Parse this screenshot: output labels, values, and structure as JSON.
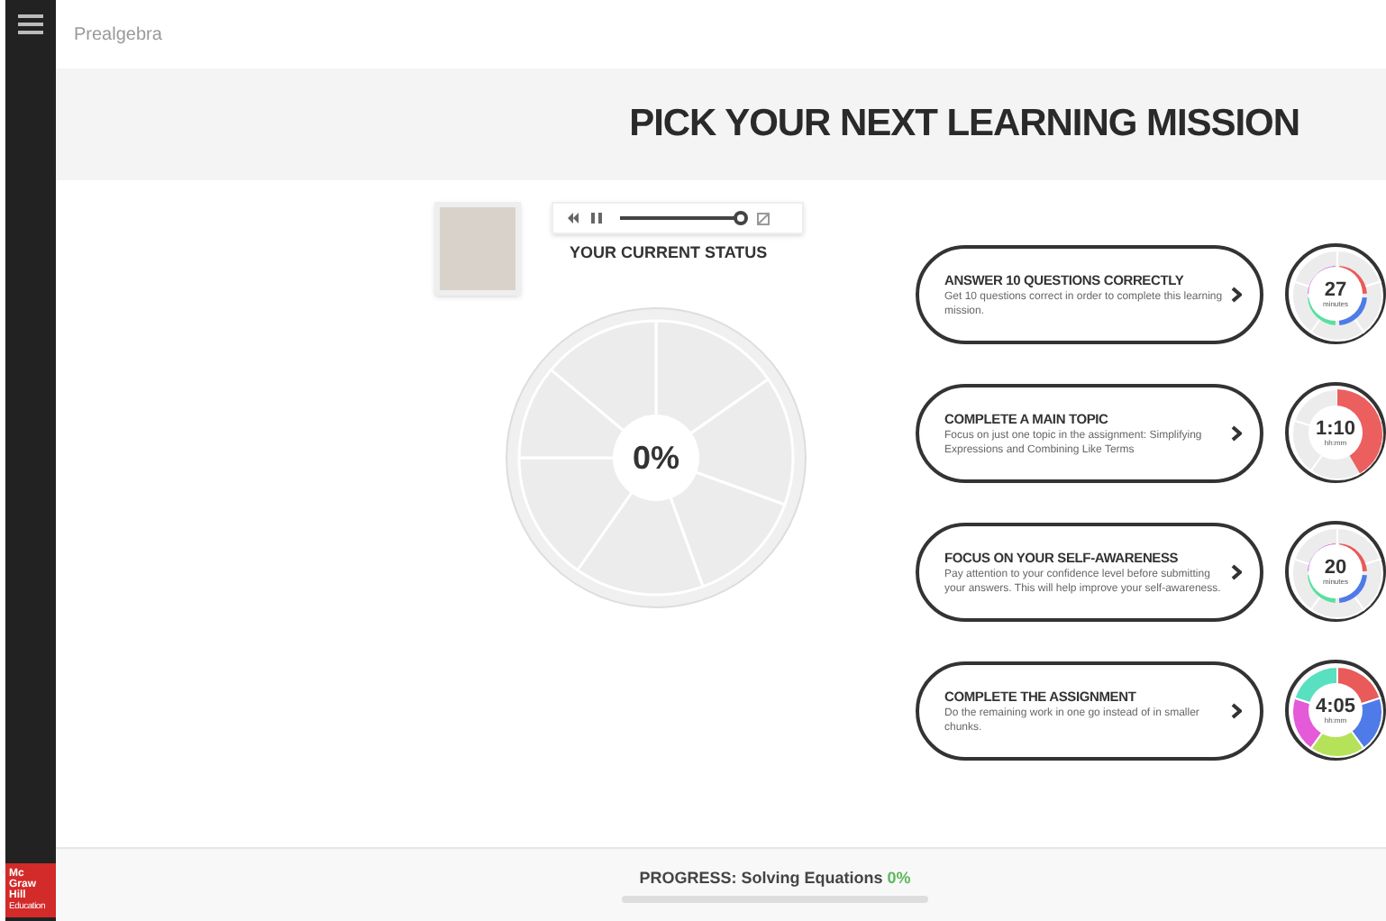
{
  "header": {
    "course": "Prealgebra"
  },
  "title": "PICK YOUR NEXT LEARNING MISSION",
  "audio": {
    "level": 0.95
  },
  "status": {
    "label": "YOUR CURRENT STATUS",
    "percent": "0%"
  },
  "missions": [
    {
      "title": "ANSWER 10 QUESTIONS CORRECTLY",
      "description": "Get 10 questions correct in order to complete this learning mission.",
      "time": "27",
      "unit": "minutes",
      "kind": "ring"
    },
    {
      "title": "COMPLETE A MAIN TOPIC",
      "description": "Focus on just one topic in the assignment: Simplifying Expressions and Combining Like Terms",
      "time": "1:10",
      "unit": "hh:mm",
      "kind": "slice"
    },
    {
      "title": "FOCUS ON YOUR SELF-AWARENESS",
      "description": "Pay attention to your confidence level before submitting your answers. This will help improve your self-awareness.",
      "time": "20",
      "unit": "minutes",
      "kind": "ring"
    },
    {
      "title": "COMPLETE THE ASSIGNMENT",
      "description": "Do the remaining work in one go instead of in smaller chunks.",
      "time": "4:05",
      "unit": "hh:mm",
      "kind": "segments"
    }
  ],
  "logo": [
    "Mc",
    "Graw",
    "Hill",
    "Education"
  ],
  "progress": {
    "label": "PROGRESS: Solving Equations",
    "percent": "0%",
    "level": 0
  }
}
